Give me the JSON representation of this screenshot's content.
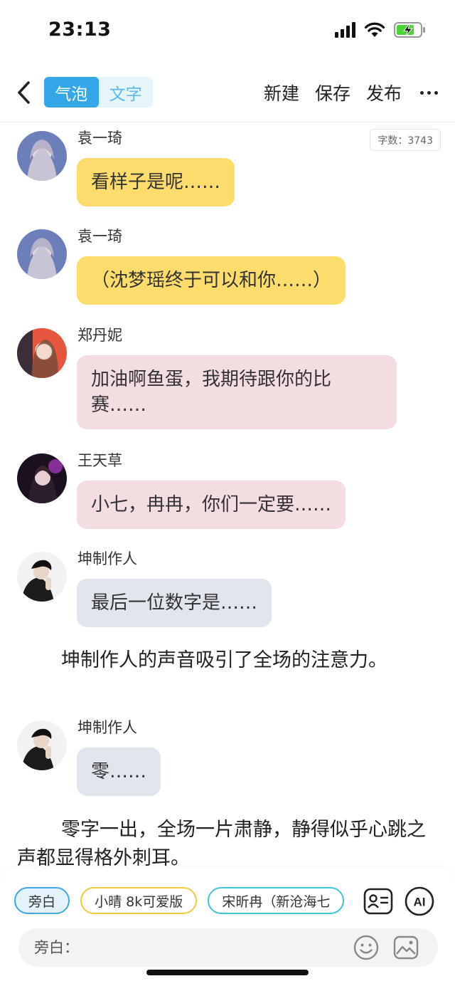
{
  "status": {
    "time": "23:13"
  },
  "nav": {
    "mode_bubble": "气泡",
    "mode_text": "文字",
    "actions": [
      "新建",
      "保存",
      "发布"
    ]
  },
  "word_count": "字数：3743",
  "messages": [
    {
      "speaker": "袁一琦",
      "text": "看样子是呢……",
      "style": "yellow",
      "avatar": "avatar-yuan"
    },
    {
      "speaker": "袁一琦",
      "text": "（沈梦瑶终于可以和你……）",
      "style": "yellow",
      "avatar": "avatar-yuan"
    },
    {
      "speaker": "郑丹妮",
      "text": "加油啊鱼蛋，我期待跟你的比赛……",
      "style": "pink",
      "avatar": "avatar-zheng"
    },
    {
      "speaker": "王天草",
      "text": "小七，冉冉，你们一定要……",
      "style": "pink",
      "avatar": "avatar-wang"
    },
    {
      "speaker": "坤制作人",
      "text": "最后一位数字是……",
      "style": "gray",
      "avatar": "avatar-kun"
    },
    {
      "speaker": "坤制作人",
      "text": "零……",
      "style": "gray",
      "avatar": "avatar-kun"
    }
  ],
  "narrations": [
    "坤制作人的声音吸引了全场的注意力。",
    "零字一出，全场一片肃静，静得似乎心跳之声都显得格外刺耳。"
  ],
  "chips": [
    "旁白",
    "小晴 8k可爱版",
    "宋昕冉（新沧海七"
  ],
  "input": {
    "placeholder": "旁白：",
    "value": ""
  },
  "ai_label": "AI",
  "colors": {
    "accent": "#35a7e8",
    "bubble_yellow": "#fddc6e",
    "bubble_pink": "#f3dde0",
    "bubble_gray": "#e1e6ee",
    "battery_green": "#4cd137"
  }
}
